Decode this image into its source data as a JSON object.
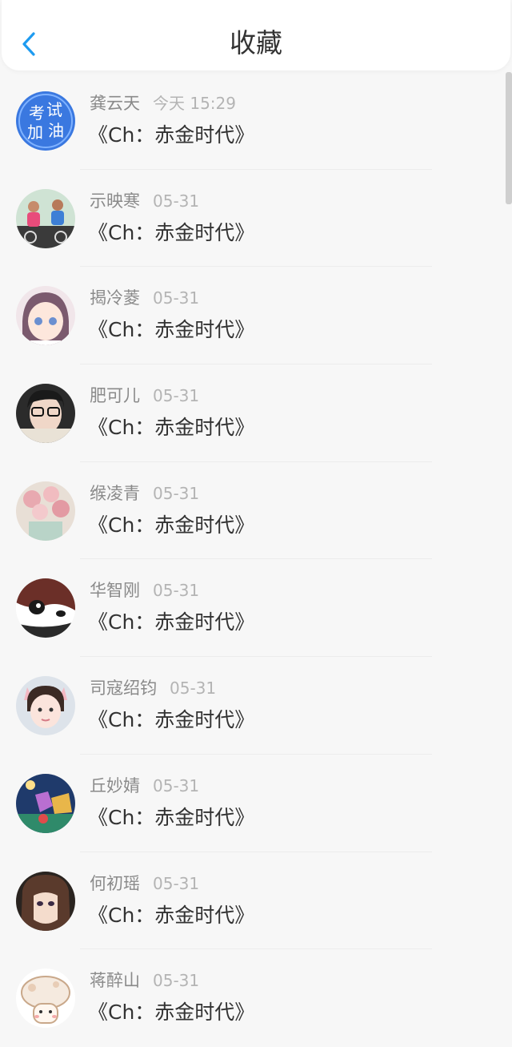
{
  "header": {
    "title": "收藏",
    "back_icon": "chevron-left-icon",
    "accent_color": "#1e9bf0"
  },
  "favorites": [
    {
      "name": "龚云天",
      "time": "今天 15:29",
      "title": "《Ch：赤金时代》",
      "avatar": "blue-text-avatar"
    },
    {
      "name": "示映寒",
      "time": "05-31",
      "title": "《Ch：赤金时代》",
      "avatar": "cyclists-photo-avatar"
    },
    {
      "name": "揭冷菱",
      "time": "05-31",
      "title": "《Ch：赤金时代》",
      "avatar": "anime-girl-avatar"
    },
    {
      "name": "肥可儿",
      "time": "05-31",
      "title": "《Ch：赤金时代》",
      "avatar": "girl-glasses-avatar"
    },
    {
      "name": "缑凌青",
      "time": "05-31",
      "title": "《Ch：赤金时代》",
      "avatar": "pink-roses-avatar"
    },
    {
      "name": "华智刚",
      "time": "05-31",
      "title": "《Ch：赤金时代》",
      "avatar": "panda-avatar"
    },
    {
      "name": "司寇绍钧",
      "time": "05-31",
      "title": "《Ch：赤金时代》",
      "avatar": "child-cat-ears-avatar"
    },
    {
      "name": "丘妙婧",
      "time": "05-31",
      "title": "《Ch：赤金时代》",
      "avatar": "cartoon-night-avatar"
    },
    {
      "name": "何初瑶",
      "time": "05-31",
      "title": "《Ch：赤金时代》",
      "avatar": "anime-brown-hair-avatar"
    },
    {
      "name": "蒋醉山",
      "time": "05-31",
      "title": "《Ch：赤金时代》",
      "avatar": "mushroom-mascot-avatar"
    }
  ]
}
